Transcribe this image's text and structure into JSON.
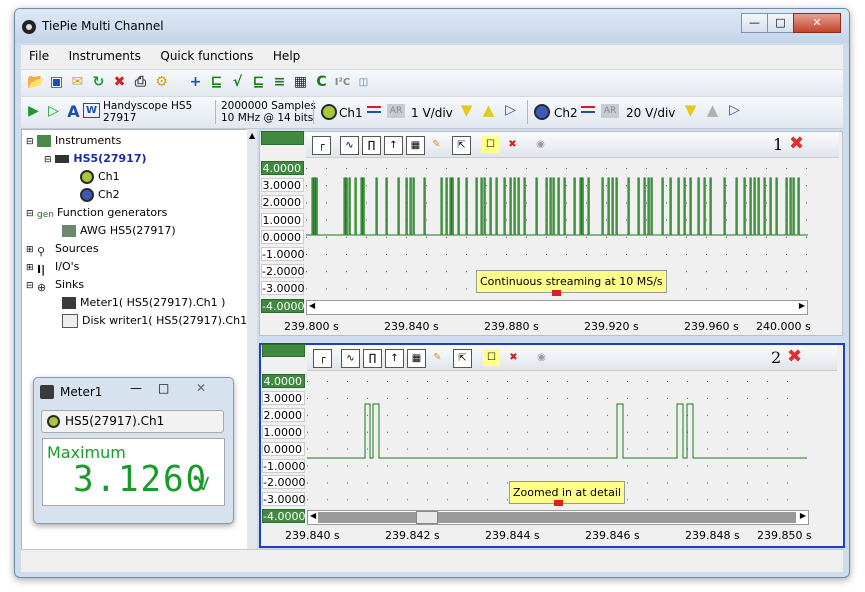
{
  "window": {
    "title": "TiePie Multi Channel"
  },
  "menu": [
    "File",
    "Instruments",
    "Quick functions",
    "Help"
  ],
  "instrument": {
    "name": "Handyscope HS5",
    "serial": "27917",
    "samples": "2000000 Samples",
    "rate_resolution": "10 MHz @ 14 bits"
  },
  "channels": [
    {
      "label": "Ch1",
      "range": "1 V/div"
    },
    {
      "label": "Ch2",
      "range": "20 V/div"
    }
  ],
  "tree": [
    {
      "label": "Instruments",
      "icon": "instrument-icon"
    },
    {
      "label": "HS5(27917)",
      "icon": "oscilloscope-icon"
    },
    {
      "label": "Ch1",
      "icon": "channel-icon"
    },
    {
      "label": "Ch2",
      "icon": "channel-icon"
    },
    {
      "label": "Function generators",
      "icon": "generator-icon"
    },
    {
      "label": "AWG HS5(27917)",
      "icon": "awg-icon"
    },
    {
      "label": "Sources",
      "icon": "source-icon"
    },
    {
      "label": "I/O's",
      "icon": "io-icon"
    },
    {
      "label": "Sinks",
      "icon": "sink-icon"
    },
    {
      "label": "Meter1( HS5(27917).Ch1 )",
      "icon": "meter-icon"
    },
    {
      "label": "Disk writer1( HS5(27917).Ch1 )",
      "icon": "disk-writer-icon"
    }
  ],
  "graphs": [
    {
      "number": "1",
      "yticks": [
        "4.0000",
        "3.0000",
        "2.0000",
        "1.0000",
        "0.0000",
        "-1.0000",
        "-2.0000",
        "-3.0000",
        "-4.0000"
      ],
      "xticks": [
        "239.800 s",
        "239.840 s",
        "239.880 s",
        "239.920 s",
        "239.960 s",
        "240.000 s"
      ],
      "hint": "Continuous streaming at 10 MS/s"
    },
    {
      "number": "2",
      "yticks": [
        "4.0000",
        "3.0000",
        "2.0000",
        "1.0000",
        "0.0000",
        "-1.0000",
        "-2.0000",
        "-3.0000",
        "-4.0000"
      ],
      "xticks": [
        "239.840 s",
        "239.842 s",
        "239.844 s",
        "239.846 s",
        "239.848 s",
        "239.850 s"
      ],
      "hint": "Zoomed in at detail"
    }
  ],
  "meter": {
    "title": "Meter1",
    "source": "HS5(27917).Ch1",
    "label": "Maximum",
    "value": "3.1260",
    "unit": "V"
  },
  "colors": {
    "trace": "#1a7a1a",
    "hint_bg": "#ffff8c",
    "active_border": "#1f3fbf",
    "close": "#e03030"
  }
}
